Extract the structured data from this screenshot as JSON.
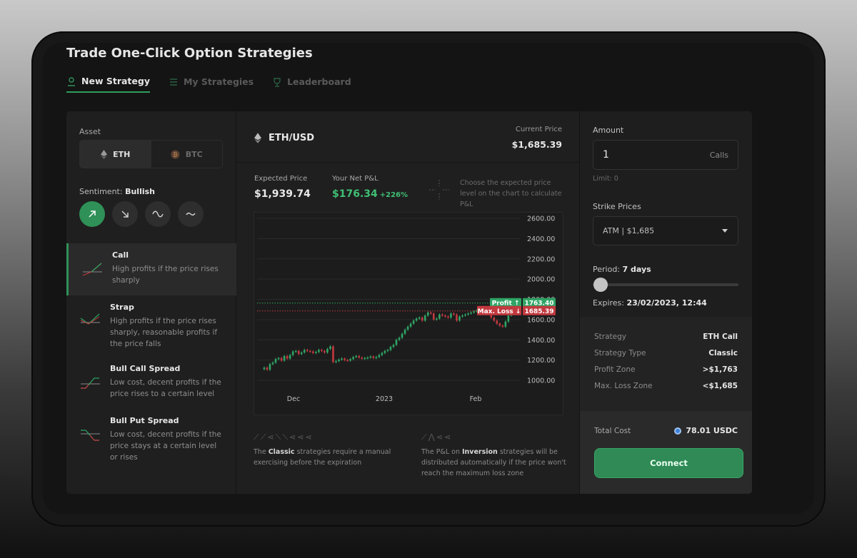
{
  "page": {
    "title": "Trade One-Click Option Strategies"
  },
  "tabs": [
    {
      "label": "New Strategy",
      "icon": "user-pin-icon",
      "active": true
    },
    {
      "label": "My Strategies",
      "icon": "list-icon",
      "active": false
    },
    {
      "label": "Leaderboard",
      "icon": "trophy-icon",
      "active": false
    }
  ],
  "left": {
    "asset_label": "Asset",
    "assets": [
      {
        "label": "ETH",
        "icon": "eth-icon",
        "active": true
      },
      {
        "label": "BTC",
        "icon": "btc-icon",
        "active": false
      }
    ],
    "sentiment_label": "Sentiment:",
    "sentiment_value": "Bullish",
    "sentiment_buttons": [
      {
        "icon": "arrow-up-right-icon",
        "active": true
      },
      {
        "icon": "arrow-down-right-icon",
        "active": false
      },
      {
        "icon": "wave-icon",
        "active": false
      },
      {
        "icon": "tilde-icon",
        "active": false
      }
    ],
    "strategies": [
      {
        "title": "Call",
        "desc": "High profits if the price rises sharply",
        "active": true
      },
      {
        "title": "Strap",
        "desc": "High profits if the price rises sharply, reasonable profits if the price falls",
        "active": false
      },
      {
        "title": "Bull Call Spread",
        "desc": "Low cost, decent profits if the price rises to a certain level",
        "active": false
      },
      {
        "title": "Bull Put Spread",
        "desc": "Low cost, decent profits if the price stays at a certain level or rises",
        "active": false
      }
    ]
  },
  "mid": {
    "pair": "ETH/USD",
    "current_price_label": "Current Price",
    "current_price": "$1,685.39",
    "expected_price_label": "Expected Price",
    "expected_price": "$1,939.74",
    "pnl_label": "Your Net P&L",
    "pnl_value": "$176.34",
    "pnl_pct": "+226%",
    "hint": "Choose the expected price level on the chart to calculate P&L",
    "note_classic_glyphs": "⟋⟋⋖⟍⟍⋖⋖⋖",
    "note_classic_pre": "The ",
    "note_classic_bold": "Classic",
    "note_classic_post": " strategies require a manual exercising before the expiration",
    "note_inv_glyphs": "⟋⋀⋖⋖",
    "note_inv_pre": "The P&L on ",
    "note_inv_bold": "Inversion",
    "note_inv_post": " strategies will be distributed automatically if the price won't reach the maximum loss zone"
  },
  "chart_data": {
    "type": "candlestick",
    "pair": "ETH/USD",
    "x_tick_labels": [
      "Dec",
      "2023",
      "Feb"
    ],
    "y_tick_labels": [
      "2600.00",
      "2400.00",
      "2200.00",
      "2000.00",
      "1800.00",
      "1600.00",
      "1400.00",
      "1200.00",
      "1000.00"
    ],
    "ylim": [
      1000,
      2600
    ],
    "grid": true,
    "profit_label": "Profit ↑",
    "profit_value": "1763.40",
    "profit_level": 1763.4,
    "loss_label": "Max. Loss ↓",
    "loss_value": "1685.39",
    "loss_level": 1685.39,
    "closes": [
      1125,
      1105,
      1160,
      1175,
      1210,
      1220,
      1195,
      1240,
      1215,
      1250,
      1285,
      1290,
      1260,
      1275,
      1300,
      1290,
      1285,
      1270,
      1280,
      1300,
      1290,
      1275,
      1310,
      1335,
      1180,
      1190,
      1205,
      1215,
      1200,
      1195,
      1210,
      1230,
      1240,
      1225,
      1215,
      1220,
      1225,
      1235,
      1220,
      1230,
      1250,
      1270,
      1290,
      1300,
      1330,
      1350,
      1400,
      1420,
      1460,
      1500,
      1530,
      1560,
      1590,
      1610,
      1620,
      1590,
      1640,
      1670,
      1660,
      1600,
      1610,
      1650,
      1640,
      1630,
      1620,
      1660,
      1650,
      1590,
      1630,
      1640,
      1650,
      1660,
      1670,
      1680,
      1690,
      1660,
      1700,
      1710,
      1680,
      1620,
      1590,
      1560,
      1540,
      1530,
      1580,
      1640,
      1685
    ]
  },
  "right": {
    "amount_label": "Amount",
    "amount_value": "1",
    "amount_unit": "Calls",
    "limit": "Limit: 0",
    "strike_label": "Strike Prices",
    "strike_value": "ATM  |  $1,685",
    "period_label": "Period:",
    "period_value": "7 days",
    "period_position": 0,
    "expires_label": "Expires:",
    "expires_value": "23/02/2023, 12:44",
    "summary": [
      {
        "k": "Strategy",
        "v": "ETH Call"
      },
      {
        "k": "Strategy Type",
        "v": "Classic"
      },
      {
        "k": "Profit Zone",
        "v": ">$1,763"
      },
      {
        "k": "Max. Loss Zone",
        "v": "<$1,685"
      }
    ],
    "total_cost_label": "Total Cost",
    "total_cost_value": "78.01 USDC",
    "connect_label": "Connect"
  },
  "colors": {
    "accent": "#2f9157",
    "profit": "#2fa565",
    "loss": "#c2393f",
    "up": "#2fa565",
    "down": "#c2393f"
  }
}
